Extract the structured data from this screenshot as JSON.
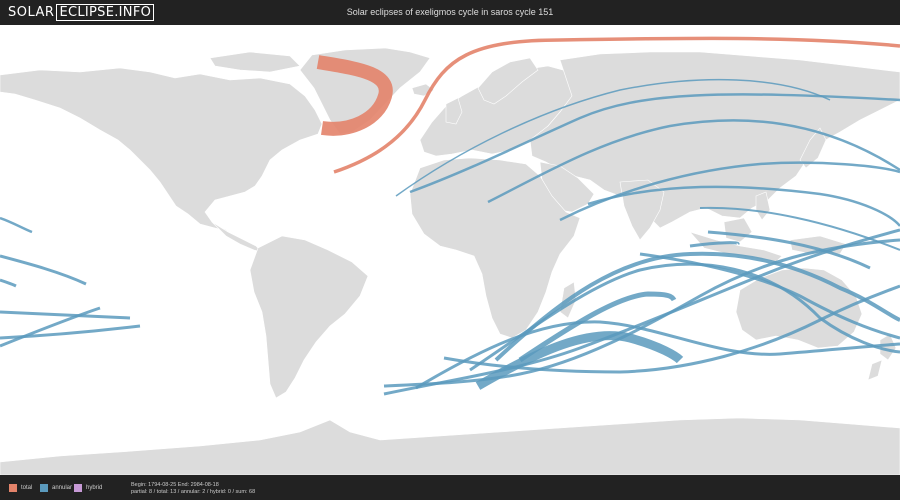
{
  "header": {
    "logo_part1": "SOLAR",
    "logo_part2": "ECLIPSE.INFO",
    "title": "Solar eclipses of exeligmos cycle in saros cycle 151"
  },
  "legend": {
    "total_label": "total",
    "annular_label": "annular",
    "hybrid_label": "hybrid",
    "total_color": "#e3836a",
    "annular_color": "#5b9abd",
    "hybrid_color": "#c79ad6"
  },
  "stats": {
    "line1": "Begin: 1794-08-25 End: 2984-08-18",
    "line2": "partial: 8 / total: 13 / annular: 2 / hybrid: 0 / sum: 68"
  },
  "map": {
    "land_color": "#dcdcdc",
    "border_color": "#ffffff",
    "ocean_color": "#ffffff"
  }
}
